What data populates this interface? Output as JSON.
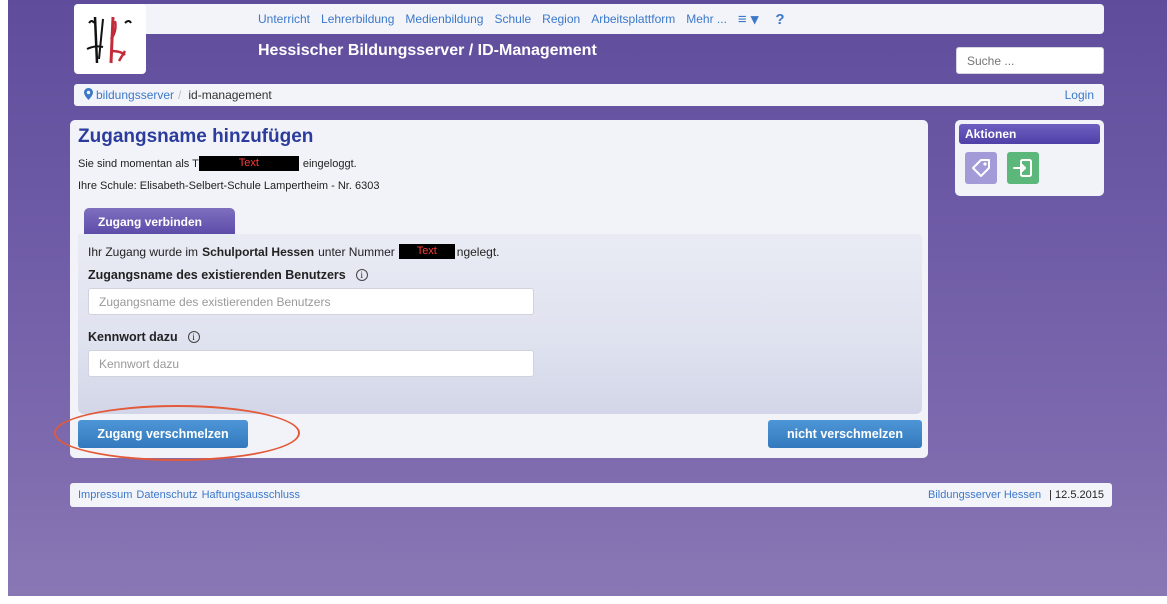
{
  "header": {
    "nav": [
      "Unterricht",
      "Lehrerbildung",
      "Medienbildung",
      "Schule",
      "Region",
      "Arbeitsplattform",
      "Mehr ..."
    ],
    "menu_icon": "≡ ▾",
    "help_icon": "?",
    "title": "Hessischer Bildungsserver / ID-Management",
    "search_placeholder": "Suche ..."
  },
  "breadcrumb": {
    "home": "bildungsserver",
    "separator": "/",
    "current": "id-management",
    "login": "Login"
  },
  "main": {
    "title": "Zugangsname hinzufügen",
    "logged_prefix": "Sie sind momentan als T",
    "logged_redacted": "Text",
    "logged_suffix": "eingeloggt.",
    "school": "Ihre Schule: Elisabeth-Selbert-Schule Lampertheim - Nr. 6303",
    "tab_label": "Zugang verbinden",
    "info_prefix": "Ihr Zugang wurde im",
    "info_bold": "Schulportal Hessen",
    "info_mid": "unter Nummer",
    "info_redacted": "Text",
    "info_suffix": "ngelegt.",
    "username_label": "Zugangsname des existierenden Benutzers",
    "username_placeholder": "Zugangsname des existierenden Benutzers",
    "password_label": "Kennwort dazu",
    "password_placeholder": "Kennwort dazu",
    "info_icon": "i",
    "merge_button": "Zugang verschmelzen",
    "nomerge_button": "nicht verschmelzen"
  },
  "sidebar": {
    "title": "Aktionen",
    "actions": [
      "tag-icon",
      "login-icon"
    ]
  },
  "footer": {
    "links": [
      "Impressum",
      "Datenschutz",
      "Haftungsausschluss"
    ],
    "right_link": "Bildungsserver Hessen",
    "date": "| 12.5.2015"
  },
  "colors": {
    "accent_blue": "#3b78c9",
    "title_blue": "#2c3c9c",
    "tab_purple": "#5b4ba8",
    "highlight": "#e35a3a"
  }
}
